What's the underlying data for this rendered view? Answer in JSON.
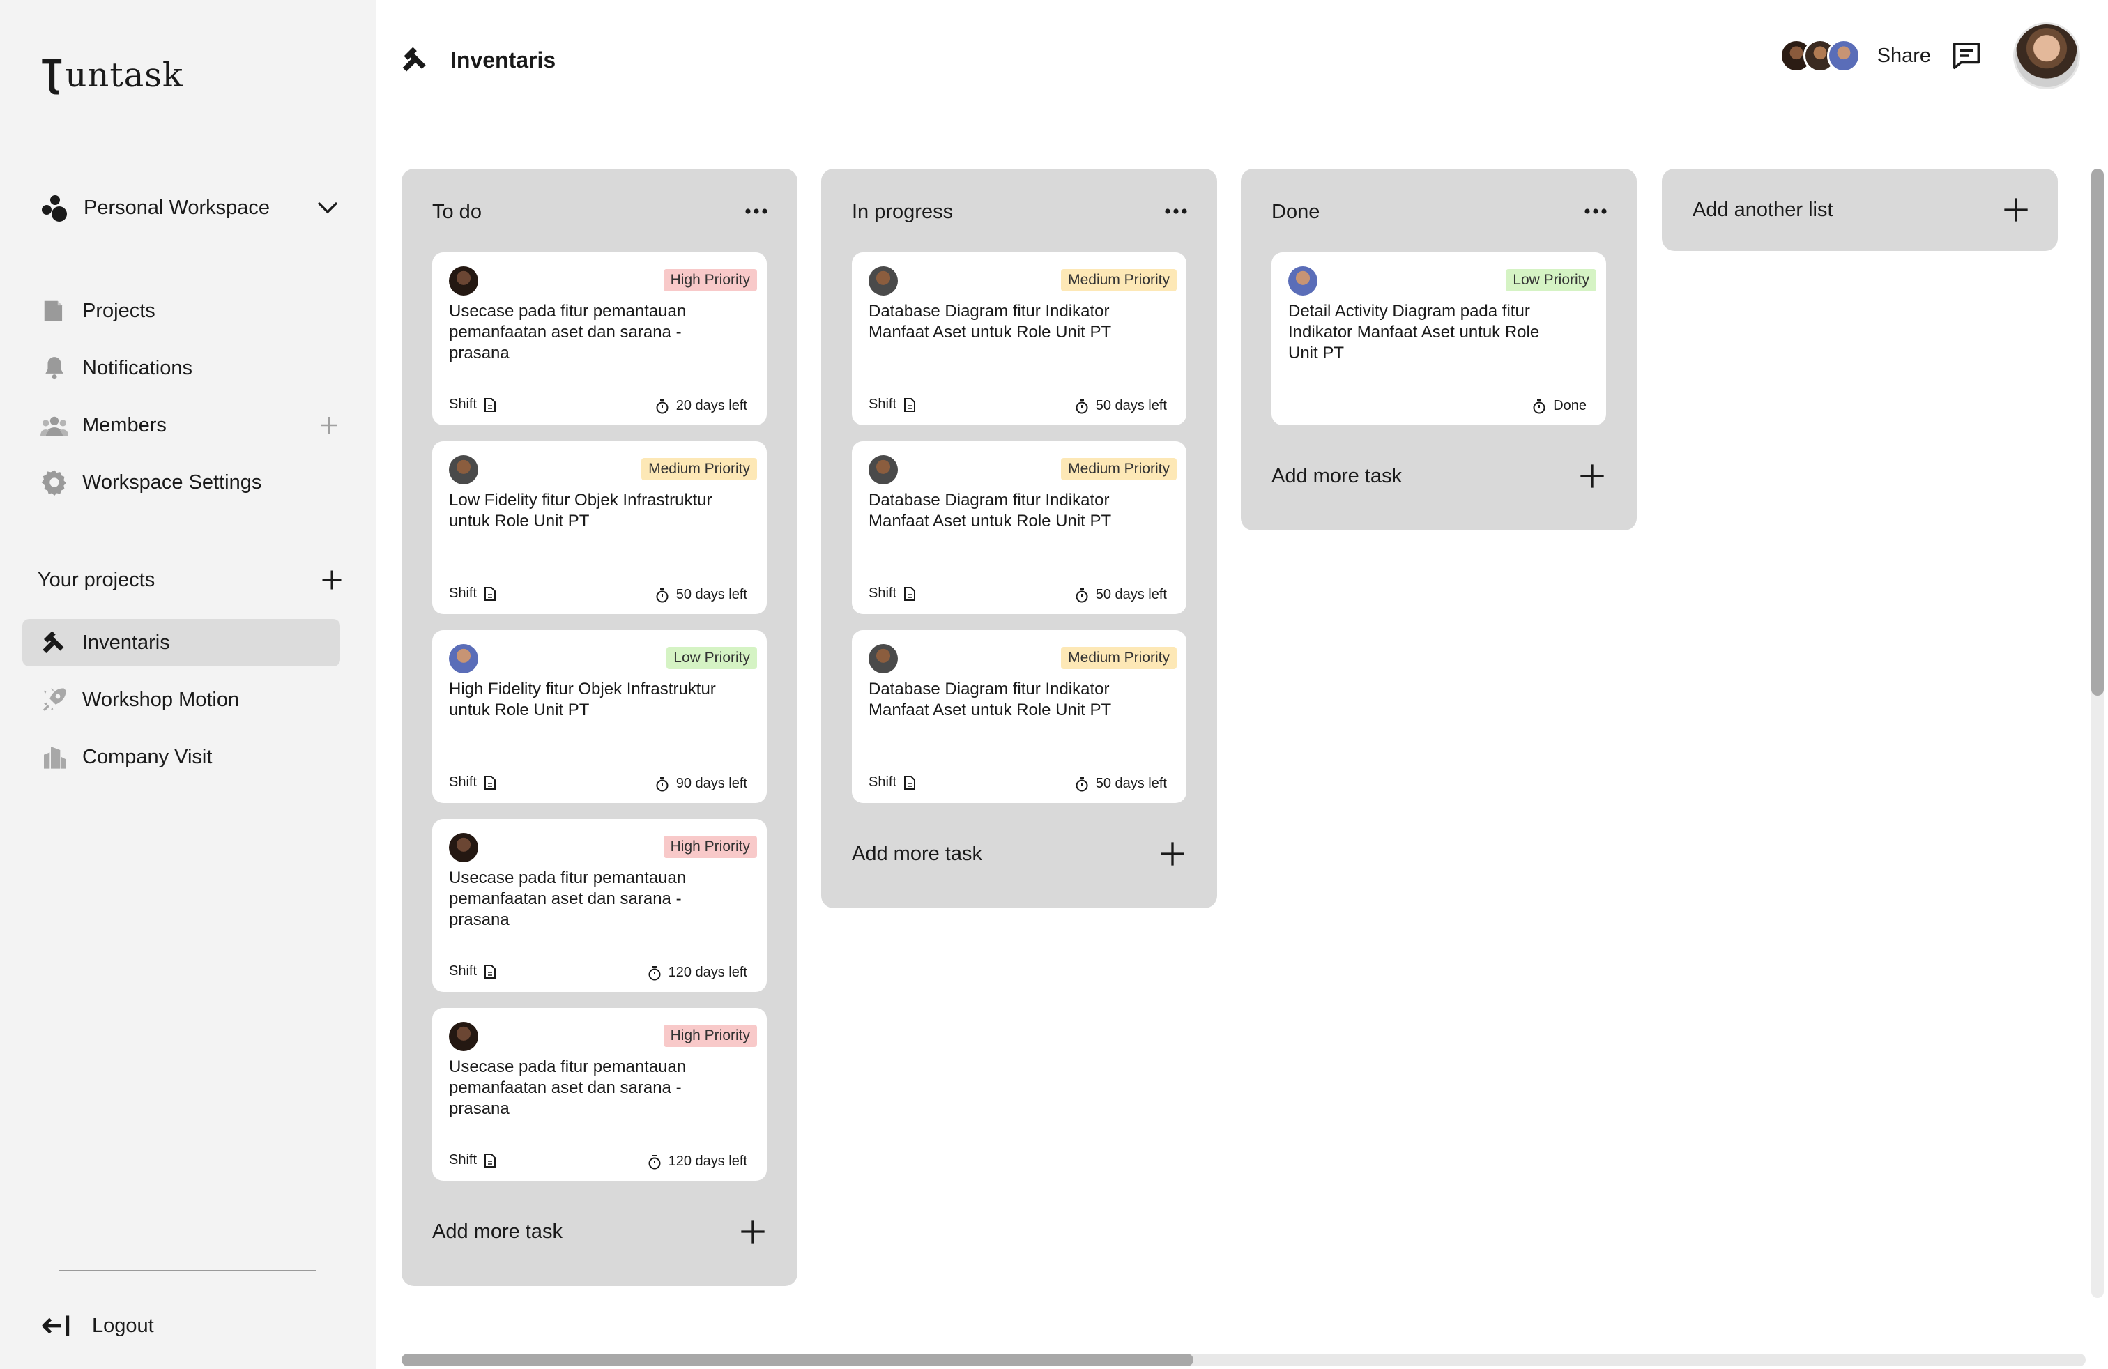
{
  "app": {
    "logo_text": "untask"
  },
  "sidebar": {
    "workspace": {
      "label": "Personal Workspace"
    },
    "nav": [
      {
        "label": "Projects",
        "icon": "projects-icon"
      },
      {
        "label": "Notifications",
        "icon": "bell-icon"
      },
      {
        "label": "Members",
        "icon": "members-icon"
      },
      {
        "label": "Workspace Settings",
        "icon": "gear-icon"
      }
    ],
    "projects_title": "Your projects",
    "projects": [
      {
        "label": "Inventaris",
        "icon": "hammer-icon",
        "active": true
      },
      {
        "label": "Workshop Motion",
        "icon": "rocket-icon",
        "active": false
      },
      {
        "label": "Company Visit",
        "icon": "building-icon",
        "active": false
      }
    ],
    "logout": "Logout"
  },
  "header": {
    "title": "Inventaris",
    "share": "Share"
  },
  "board": {
    "add_task_label": "Add more task",
    "add_list_label": "Add another list",
    "columns": [
      {
        "title": "To do",
        "cards": [
          {
            "priority": "High Priority",
            "title": "Usecase pada fitur pemantauan pemanfaatan aset dan sarana - prasana",
            "assignee": "Shift",
            "due": "20 days left"
          },
          {
            "priority": "Medium Priority",
            "title": "Low Fidelity fitur Objek Infrastruktur untuk Role Unit PT",
            "assignee": "Shift",
            "due": "50 days left"
          },
          {
            "priority": "Low Priority",
            "title": "High Fidelity fitur Objek Infrastruktur untuk Role Unit PT",
            "assignee": "Shift",
            "due": "90 days left"
          },
          {
            "priority": "High Priority",
            "title": "Usecase pada fitur pemantauan pemanfaatan aset dan sarana - prasana",
            "assignee": "Shift",
            "due": "120 days left"
          },
          {
            "priority": "High Priority",
            "title": "Usecase pada fitur pemantauan pemanfaatan aset dan sarana - prasana",
            "assignee": "Shift",
            "due": "120 days left"
          }
        ]
      },
      {
        "title": "In progress",
        "cards": [
          {
            "priority": "Medium Priority",
            "title": "Database Diagram fitur Indikator Manfaat Aset untuk Role Unit PT",
            "assignee": "Shift",
            "due": "50 days left"
          },
          {
            "priority": "Medium Priority",
            "title": "Database Diagram fitur Indikator Manfaat Aset untuk Role Unit PT",
            "assignee": "Shift",
            "due": "50 days left"
          },
          {
            "priority": "Medium Priority",
            "title": "Database Diagram fitur Indikator Manfaat Aset untuk Role Unit PT",
            "assignee": "Shift",
            "due": "50 days left"
          }
        ]
      },
      {
        "title": "Done",
        "cards": [
          {
            "priority": "Low Priority",
            "title": "Detail Activity Diagram pada fitur Indikator Manfaat Aset untuk Role Unit PT",
            "assignee": "",
            "due": "Done"
          }
        ]
      }
    ]
  },
  "colors": {
    "sidebar_bg": "#f3f3f3",
    "column_bg": "#d9d9d9",
    "high": "#f8c9c9",
    "medium": "#fde8b6",
    "low": "#d5f3c4"
  }
}
